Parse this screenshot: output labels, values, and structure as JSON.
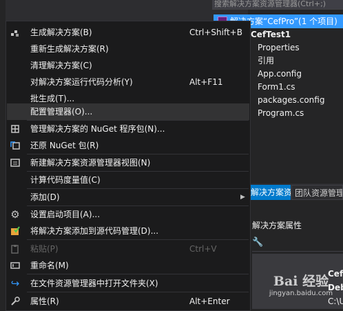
{
  "background": {
    "search_placeholder": "搜索解决方案资源管理器(Ctrl+;)",
    "tree": {
      "solution_label": "解决方案“CefPro”(1 个项目)",
      "project_label": "CefTest1",
      "items": [
        "Properties",
        "引用",
        "App.config",
        "Form1.cs",
        "packages.config",
        "Program.cs"
      ]
    },
    "tabs": [
      "解决方案资源管理器",
      "团队资源管理器"
    ],
    "properties": {
      "title": "解决方案属性",
      "name_value": "Cef",
      "config_value": "Deb",
      "path_value": "C:\\U"
    },
    "watermark": {
      "text": "Bai 经验",
      "url": "jingyan.baidu.com"
    }
  },
  "menu": {
    "items": [
      {
        "label": "生成解决方案(B)",
        "shortcut": "Ctrl+Shift+B",
        "icon": "build-icon"
      },
      {
        "label": "重新生成解决方案(R)",
        "shortcut": "",
        "icon": ""
      },
      {
        "label": "清理解决方案(C)",
        "shortcut": "",
        "icon": ""
      },
      {
        "label": "对解决方案运行代码分析(Y)",
        "shortcut": "Alt+F11",
        "icon": ""
      },
      {
        "label": "批生成(T)...",
        "shortcut": "",
        "icon": ""
      },
      {
        "label": "配置管理器(O)...",
        "shortcut": "",
        "icon": ""
      },
      {
        "label": "管理解决方案的 NuGet 程序包(N)...",
        "shortcut": "",
        "icon": "nuget-package-icon"
      },
      {
        "label": "还原 NuGet 包(R)",
        "shortcut": "",
        "icon": "restore-package-icon"
      },
      {
        "label": "新建解决方案资源管理器视图(N)",
        "shortcut": "",
        "icon": "new-view-icon"
      },
      {
        "label": "计算代码度量值(C)",
        "shortcut": "",
        "icon": ""
      },
      {
        "label": "添加(D)",
        "shortcut": "",
        "icon": "",
        "submenu_arrow": "▶"
      },
      {
        "label": "设置启动项目(A)...",
        "shortcut": "",
        "icon": "gear-icon"
      },
      {
        "label": "将解决方案添加到源代码管理(D)...",
        "shortcut": "",
        "icon": "source-control-icon"
      },
      {
        "label": "粘贴(P)",
        "shortcut": "Ctrl+V",
        "icon": "paste-icon",
        "disabled": true
      },
      {
        "label": "重命名(M)",
        "shortcut": "",
        "icon": "rename-icon"
      },
      {
        "label": "在文件资源管理器中打开文件夹(X)",
        "shortcut": "",
        "icon": "open-folder-icon"
      },
      {
        "label": "属性(R)",
        "shortcut": "Alt+Enter",
        "icon": "wrench-icon"
      }
    ],
    "hovered_label": "配置管理器(O)..."
  },
  "colors": {
    "menu_bg": "#1b1b1c",
    "hover_bg": "#333334",
    "selection_blue": "#3399ff",
    "accent_blue": "#007acc",
    "disabled_text": "#656565"
  }
}
